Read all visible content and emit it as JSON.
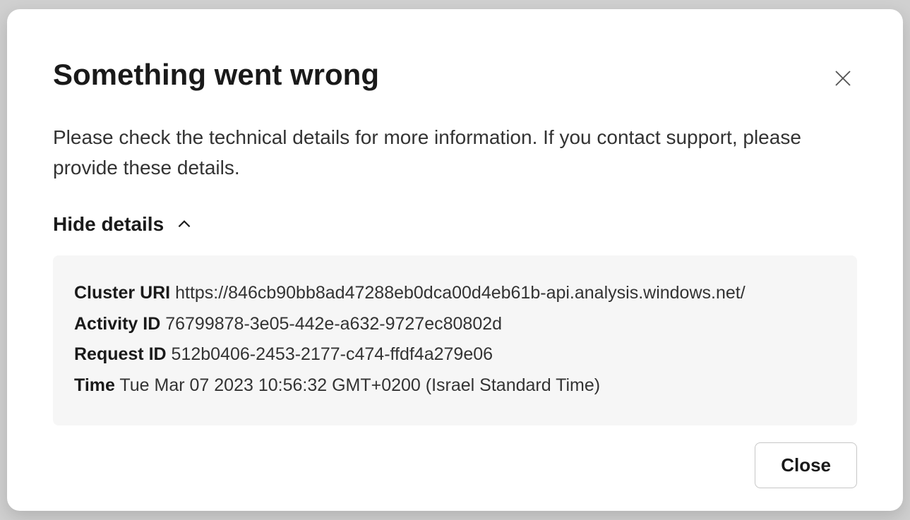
{
  "dialog": {
    "title": "Something went wrong",
    "message": "Please check the technical details for more information. If you contact support, please provide these details.",
    "toggle_label": "Hide details",
    "close_button_label": "Close"
  },
  "details": {
    "cluster_uri_label": "Cluster URI",
    "cluster_uri_value": "https://846cb90bb8ad47288eb0dca00d4eb61b-api.analysis.windows.net/",
    "activity_id_label": "Activity ID",
    "activity_id_value": "76799878-3e05-442e-a632-9727ec80802d",
    "request_id_label": "Request ID",
    "request_id_value": "512b0406-2453-2177-c474-ffdf4a279e06",
    "time_label": "Time",
    "time_value": "Tue Mar 07 2023 10:56:32 GMT+0200 (Israel Standard Time)"
  }
}
